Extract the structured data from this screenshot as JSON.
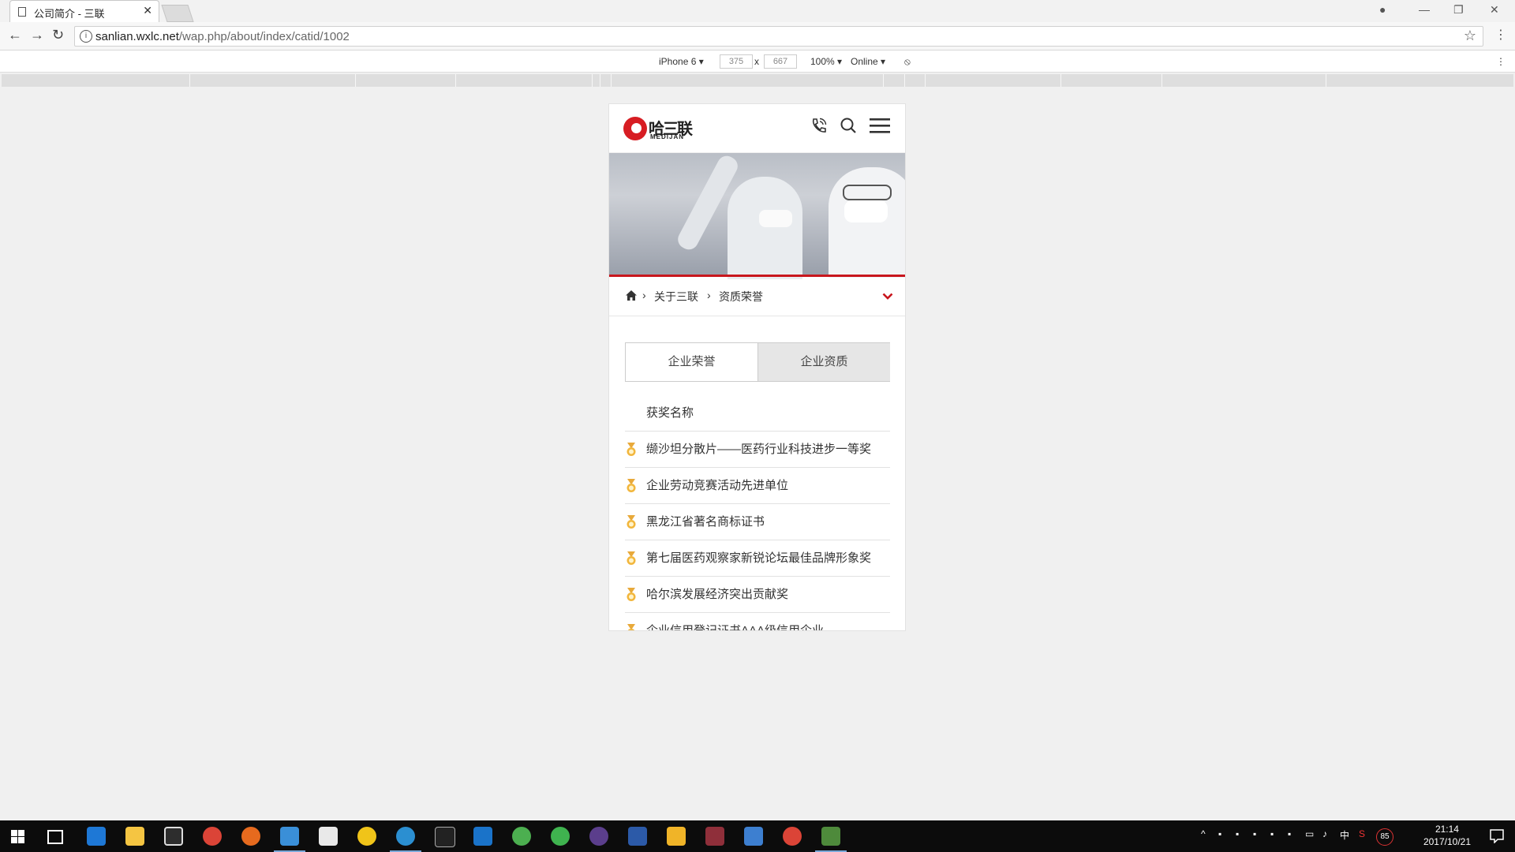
{
  "browser": {
    "tab_title": "公司简介 - 三联",
    "url_host": "sanlian.wxlc.net",
    "url_path": "/wap.php/about/index/catid/1002"
  },
  "device_toolbar": {
    "device": "iPhone 6",
    "width": "375",
    "height": "667",
    "zoom": "100%",
    "network": "Online",
    "separator": "x"
  },
  "site": {
    "logo_cn": "哈三联",
    "logo_en": "MEDIJAN",
    "breadcrumb": [
      "关于三联",
      "资质荣誉"
    ],
    "tabs": [
      {
        "label": "企业荣誉",
        "active": true
      },
      {
        "label": "企业资质",
        "active": false
      }
    ],
    "list_header": "获奖名称",
    "awards": [
      "缬沙坦分散片——医药行业科技进步一等奖",
      "企业劳动竞赛活动先进单位",
      "黑龙江省著名商标证书",
      "第七届医药观察家新锐论坛最佳品牌形象奖",
      "哈尔滨发展经济突出贡献奖",
      "企业信用登记证书AAA级信用企业"
    ],
    "accent_color": "#c8161d"
  },
  "taskbar": {
    "time": "21:14",
    "date": "2017/10/21",
    "ime": "中",
    "badge": "85"
  }
}
